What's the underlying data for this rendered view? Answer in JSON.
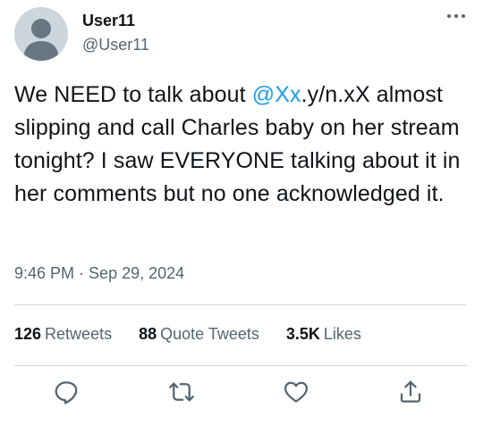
{
  "user": {
    "display_name": "User11",
    "handle": "@User11"
  },
  "tweet": {
    "text_before": "We NEED to talk about ",
    "mention": "@Xx",
    "text_after": ".y/n.xX almost slipping and call Charles baby on her stream tonight? I saw EVERYONE talking about it in her comments but no one acknowledged it.",
    "time": "9:46 PM",
    "separator": " · ",
    "date": "Sep 29, 2024"
  },
  "stats": {
    "retweets_count": "126",
    "retweets_label": "Retweets",
    "quotes_count": "88",
    "quotes_label": "Quote Tweets",
    "likes_count": "3.5K",
    "likes_label": "Likes"
  },
  "icons": {
    "more": "more-dots-icon",
    "reply": "reply-icon",
    "retweet": "retweet-icon",
    "like": "heart-icon",
    "share": "share-icon"
  },
  "colors": {
    "accent": "#1d9bf0",
    "secondary_text": "#536471",
    "icon": "#536471",
    "divider": "#cfd9de"
  }
}
